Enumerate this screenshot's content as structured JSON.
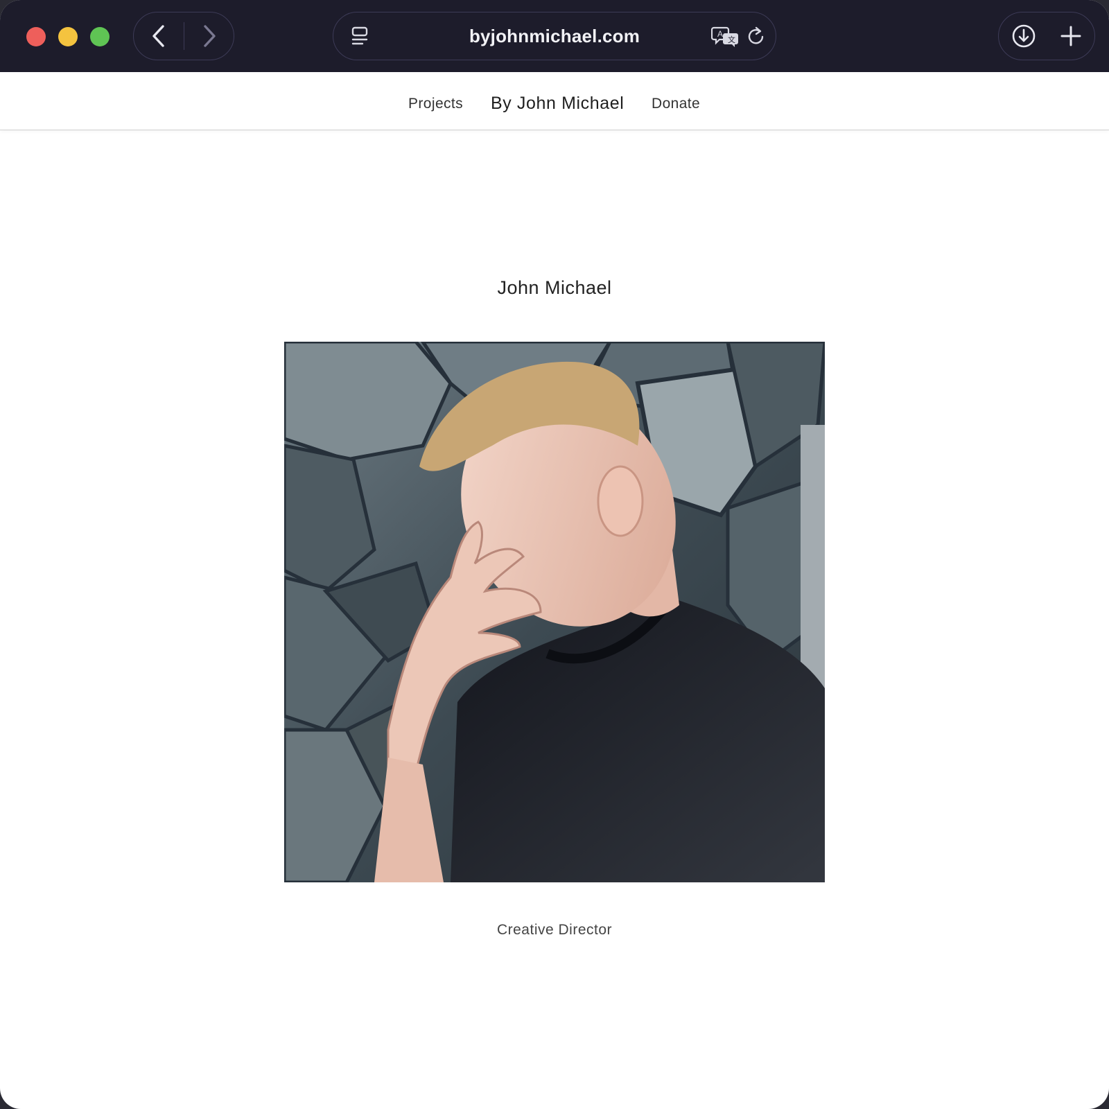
{
  "browser": {
    "url": "byjohnmichael.com",
    "icons": {
      "back": "chevron-left-icon",
      "forward": "chevron-right-icon",
      "tabs": "tab-overview-icon",
      "translate": "translate-icon",
      "reload": "reload-icon",
      "download": "download-icon",
      "new_tab": "plus-icon"
    },
    "colors": {
      "toolbar": "#1d1c2b",
      "close": "#ee5f5b",
      "minimize": "#f4c33f",
      "zoom": "#5fc454"
    }
  },
  "site_nav": {
    "projects": "Projects",
    "brand": "By John Michael",
    "donate": "Donate"
  },
  "profile": {
    "name": "John Michael",
    "role": "Creative Director"
  }
}
